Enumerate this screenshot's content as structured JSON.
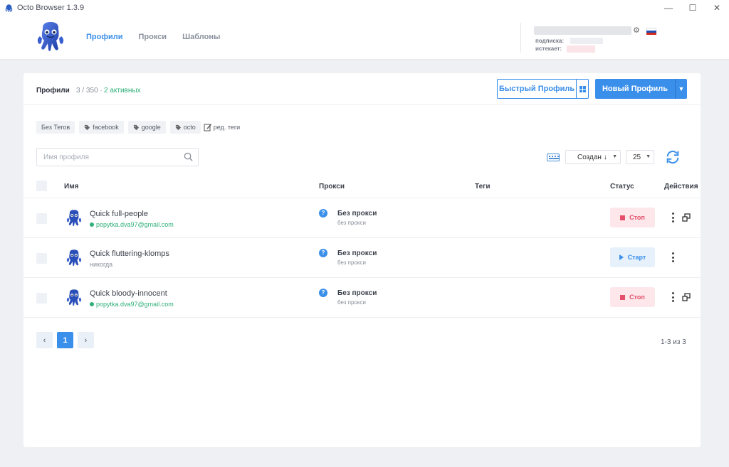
{
  "window": {
    "title": "Octo Browser 1.3.9",
    "controls": [
      "—",
      "☐",
      "✕"
    ]
  },
  "nav": {
    "items": [
      {
        "label": "Профили",
        "active": true
      },
      {
        "label": "Прокси",
        "active": false
      },
      {
        "label": "Шаблоны",
        "active": false
      }
    ]
  },
  "account": {
    "subscription_label": "подписка:",
    "expires_label": "истекает:"
  },
  "profiles": {
    "title": "Профили",
    "count": "3 / 350",
    "separator": "·",
    "active": "2 активных",
    "quick_button": "Быстрый Профиль",
    "new_button": "Новый Профиль"
  },
  "tags": {
    "items": [
      "Без Тегов",
      "facebook",
      "google",
      "octo"
    ],
    "edit_label": "ред. теги"
  },
  "search": {
    "placeholder": "Имя профиля"
  },
  "sort": {
    "label": "Создан ↓",
    "per_page": "25"
  },
  "table": {
    "headers": {
      "name": "Имя",
      "proxy": "Прокси",
      "tags": "Теги",
      "status": "Статус",
      "actions": "Действия"
    },
    "rows": [
      {
        "name": "Quick full-people",
        "sub": "popytka.dva97@gmail.com",
        "online": true,
        "proxy": "Без прокси",
        "proxy_sub": "без прокси",
        "status": "Стоп",
        "running": true
      },
      {
        "name": "Quick fluttering-klomps",
        "sub": "никогда",
        "online": false,
        "proxy": "Без прокси",
        "proxy_sub": "без прокси",
        "status": "Старт",
        "running": false
      },
      {
        "name": "Quick bloody-innocent",
        "sub": "popytka.dva97@gmail.com",
        "online": true,
        "proxy": "Без прокси",
        "proxy_sub": "без прокси",
        "status": "Стоп",
        "running": true
      }
    ]
  },
  "pagination": {
    "prev": "‹",
    "current": "1",
    "next": "›",
    "range": "1-3 из 3"
  },
  "colors": {
    "accent": "#3a8fea",
    "stop": "#e4506a",
    "online": "#2fb078"
  }
}
